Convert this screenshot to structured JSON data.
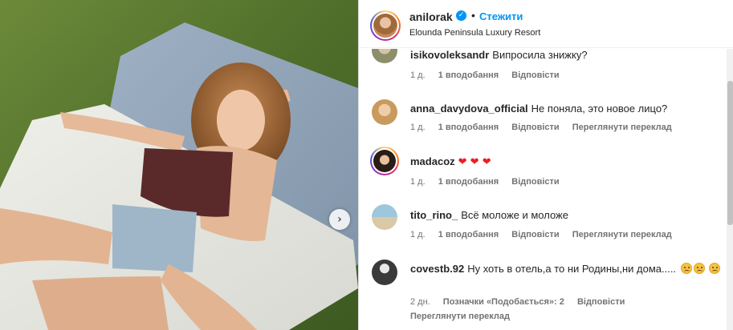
{
  "post": {
    "username": "anilorak",
    "verified_icon": "verified-badge-icon",
    "separator": "•",
    "follow_label": "Стежити",
    "location": "Elounda Peninsula Luxury Resort",
    "carousel_next_icon": "chevron-right-icon",
    "carousel_next_glyph": "›",
    "photo_description_icon": "post-photo"
  },
  "comments": [
    {
      "username": "isikovoleksandr",
      "text": "Випросила знижку?",
      "time": "1 д.",
      "likes": "1 вподобання",
      "reply": "Відповісти",
      "translate": ""
    },
    {
      "username": "anna_davydova_official",
      "text": "Не поняла, это новое лицо?",
      "time": "1 д.",
      "likes": "1 вподобання",
      "reply": "Відповісти",
      "translate": "Переглянути переклад"
    },
    {
      "username": "madacoz",
      "text": "❤ ❤ ❤",
      "time": "1 д.",
      "likes": "1 вподобання",
      "reply": "Відповісти",
      "translate": ""
    },
    {
      "username": "tito_rino_",
      "text": "Всё моложе и моложе",
      "time": "1 д.",
      "likes": "1 вподобання",
      "reply": "Відповісти",
      "translate": "Переглянути переклад"
    },
    {
      "username": "covestb.92",
      "text": "Ну хоть в отель,а то ни Родины,ни дома.....",
      "time": "2 дн.",
      "likes": "Позначки «Подобається»: 2",
      "reply": "Відповісти",
      "translate": "Переглянути переклад"
    }
  ],
  "colors": {
    "accent": "#0095f6",
    "heart": "#ed1c24",
    "meta": "#737373"
  }
}
